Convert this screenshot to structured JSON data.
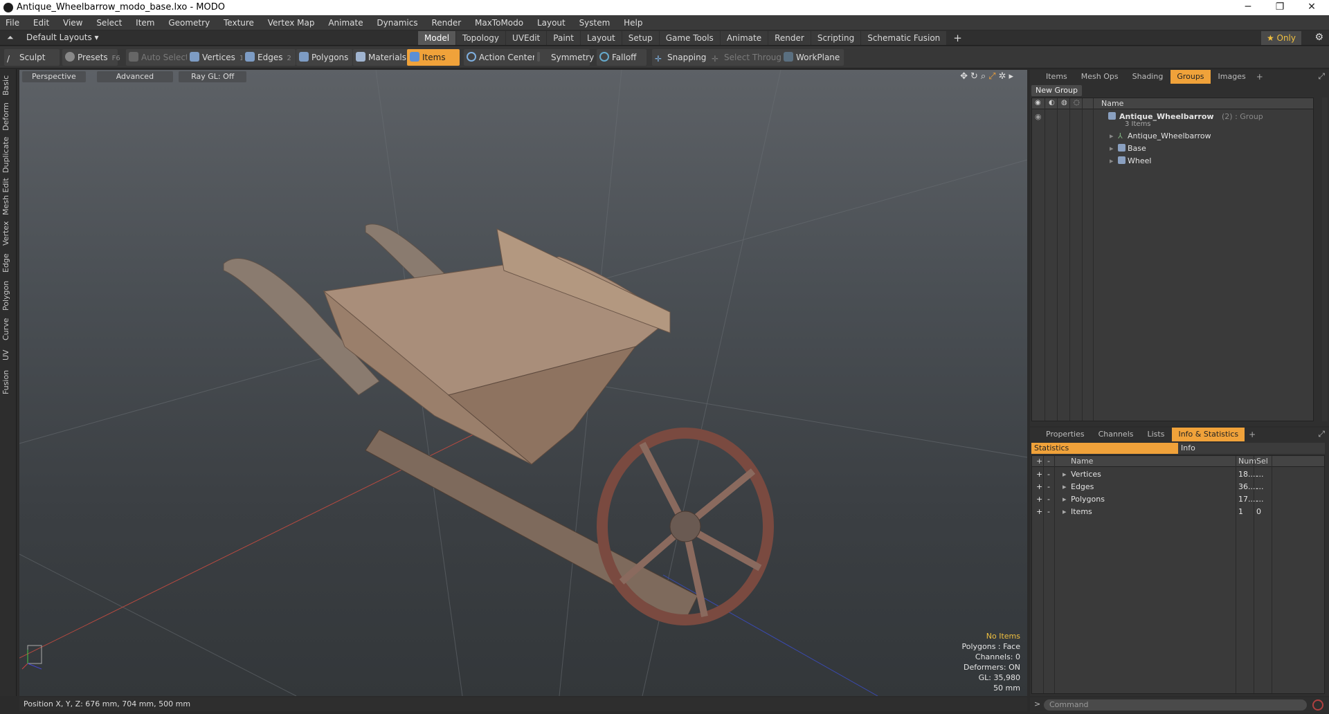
{
  "window": {
    "title": "Antique_Wheelbarrow_modo_base.lxo - MODO",
    "minimize": "─",
    "maximize": "❐",
    "close": "✕"
  },
  "menu": [
    "File",
    "Edit",
    "View",
    "Select",
    "Item",
    "Geometry",
    "Texture",
    "Vertex Map",
    "Animate",
    "Dynamics",
    "Render",
    "MaxToModo",
    "Layout",
    "System",
    "Help"
  ],
  "layoutbar": {
    "layout_label": "Default Layouts ▾",
    "tabs": [
      "Model",
      "Topology",
      "UVEdit",
      "Paint",
      "Layout",
      "Setup",
      "Game Tools",
      "Animate",
      "Render",
      "Scripting",
      "Schematic Fusion"
    ],
    "active_tab": "Model",
    "add": "+",
    "only": "★ Only"
  },
  "toolbar": {
    "sculpt": "Sculpt",
    "presets": "Presets",
    "presets_key": "F6",
    "auto_select": "Auto Select",
    "vertices": "Vertices",
    "vertices_key": "1",
    "edges": "Edges",
    "edges_key": "2",
    "polygons": "Polygons",
    "materials": "Materials",
    "items": "Items",
    "action_center": "Action Center",
    "symmetry": "Symmetry",
    "falloff": "Falloff",
    "snapping": "Snapping",
    "select_through": "Select Through",
    "workplane": "WorkPlane"
  },
  "left_tabs": [
    "Basic",
    "Deform",
    "Duplicate",
    "Mesh Edit",
    "Vertex",
    "Edge",
    "Polygon",
    "Curve",
    "UV",
    "Fusion"
  ],
  "viewport": {
    "view": "Perspective",
    "shading": "Advanced",
    "raygl": "Ray GL: Off",
    "info": {
      "no_items": "No Items",
      "polygons": "Polygons : Face",
      "channels": "Channels: 0",
      "deformers": "Deformers: ON",
      "gl": "GL: 35,980",
      "scale": "50 mm"
    }
  },
  "status": {
    "position": "Position X, Y, Z:  676 mm, 704 mm, 500 mm"
  },
  "groups_panel": {
    "tabs": [
      "Items",
      "Mesh Ops",
      "Shading",
      "Groups",
      "Images"
    ],
    "active_tab": "Groups",
    "new_group": "New Group",
    "col_name": "Name",
    "group_name": "Antique_Wheelbarrow",
    "group_suffix": "(2) : Group",
    "group_count": "3 Items",
    "children": [
      "Antique_Wheelbarrow",
      "Base",
      "Wheel"
    ]
  },
  "info_panel": {
    "tabs": [
      "Properties",
      "Channels",
      "Lists",
      "Info & Statistics"
    ],
    "active_tab": "Info & Statistics",
    "sub_tabs": [
      "Statistics",
      "Info"
    ],
    "columns": {
      "name": "Name",
      "num": "Num",
      "sel": "Sel"
    },
    "rows": [
      {
        "name": "Vertices",
        "num": "18....",
        "sel": "..."
      },
      {
        "name": "Edges",
        "num": "36....",
        "sel": "..."
      },
      {
        "name": "Polygons",
        "num": "17....",
        "sel": "..."
      },
      {
        "name": "Items",
        "num": "1",
        "sel": "0"
      }
    ]
  },
  "command": {
    "placeholder": "Command",
    "prompt": ">"
  }
}
